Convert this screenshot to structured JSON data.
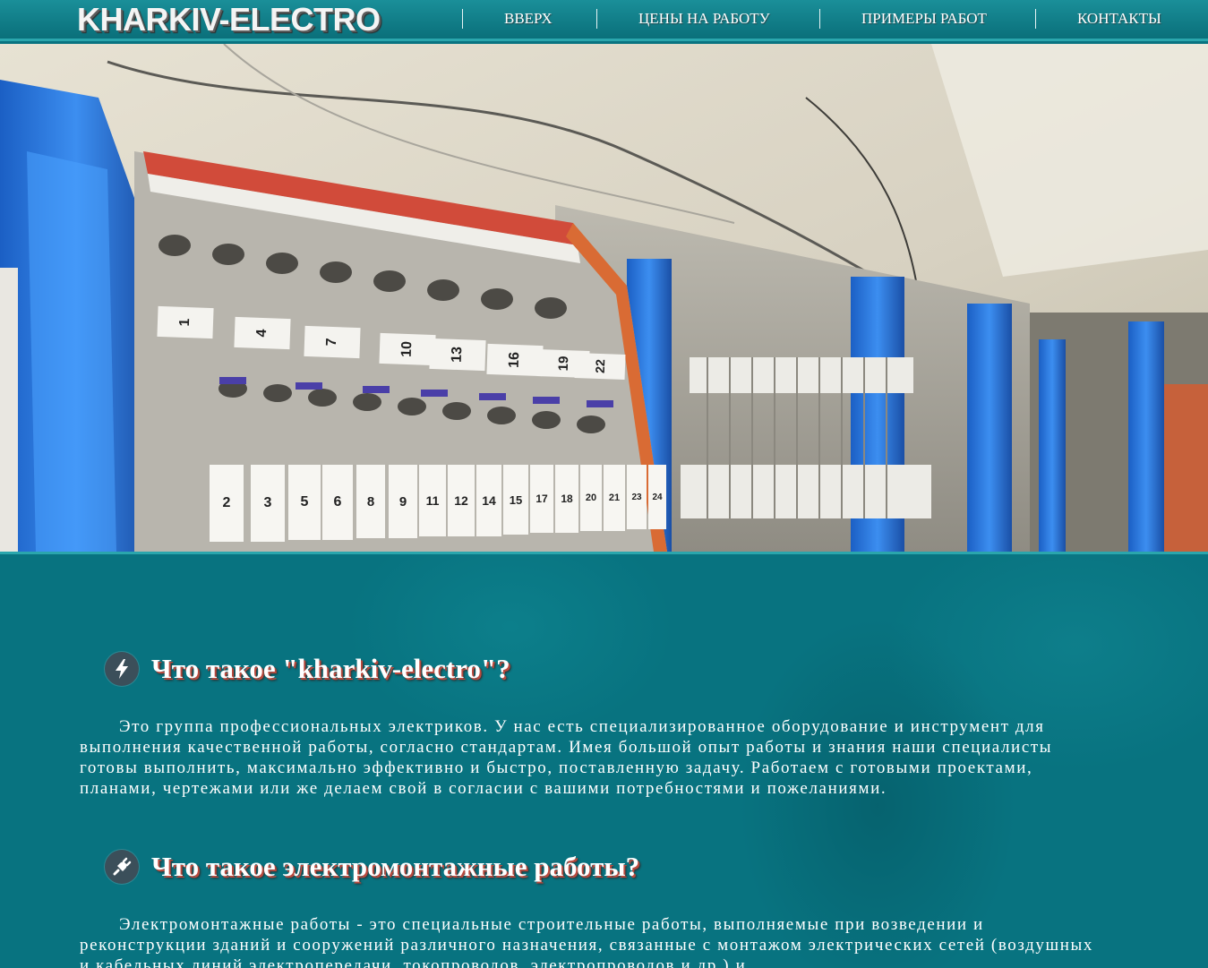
{
  "header": {
    "logo": "KHARKIV-ELECTRO",
    "nav": [
      {
        "label": "ВВЕРХ"
      },
      {
        "label": "ЦЕНЫ НА РАБОТУ"
      },
      {
        "label": "ПРИМЕРЫ РАБОТ"
      },
      {
        "label": "КОНТАКТЫ"
      }
    ]
  },
  "hero": {
    "image": "electrical-terminal-blocks-photo",
    "terminal_numbers_top": [
      "1",
      "4",
      "7",
      "10",
      "13",
      "16",
      "19",
      "22"
    ],
    "terminal_numbers_bottom": [
      "2",
      "3",
      "5",
      "6",
      "8",
      "9",
      "11",
      "12",
      "14",
      "15",
      "17",
      "18",
      "20",
      "21",
      "23",
      "24"
    ]
  },
  "sections": [
    {
      "icon": "lightning-icon",
      "title": "Что такое \"kharkiv-electro\"?",
      "text": "Это группа профессиональных электриков. У нас есть специализированное оборудование и инструмент для выполнения качественной работы, согласно стандартам. Имея большой опыт работы и знания наши специалисты готовы выполнить, максимально эффективно и быстро, поставленную задачу. Работаем с готовыми проектами, планами, чертежами или же делаем свой в согласии с вашими потребностями и пожеланиями."
    },
    {
      "icon": "plug-icon",
      "title": "Что такое электромонтажные работы?",
      "text": "Электромонтажные работы - это специальные строительные работы, выполняемые при возведении и реконструкции зданий и сооружений различного назначения, связанные с монтажом электрических сетей (воздушных и кабельных линий электропередачи, токопроводов, электропроводов и др.) и"
    }
  ],
  "colors": {
    "background": "#087380",
    "header": "#0d7c86",
    "title_shadow": "#b94a3e",
    "icon_circle": "#3b4f5a"
  }
}
